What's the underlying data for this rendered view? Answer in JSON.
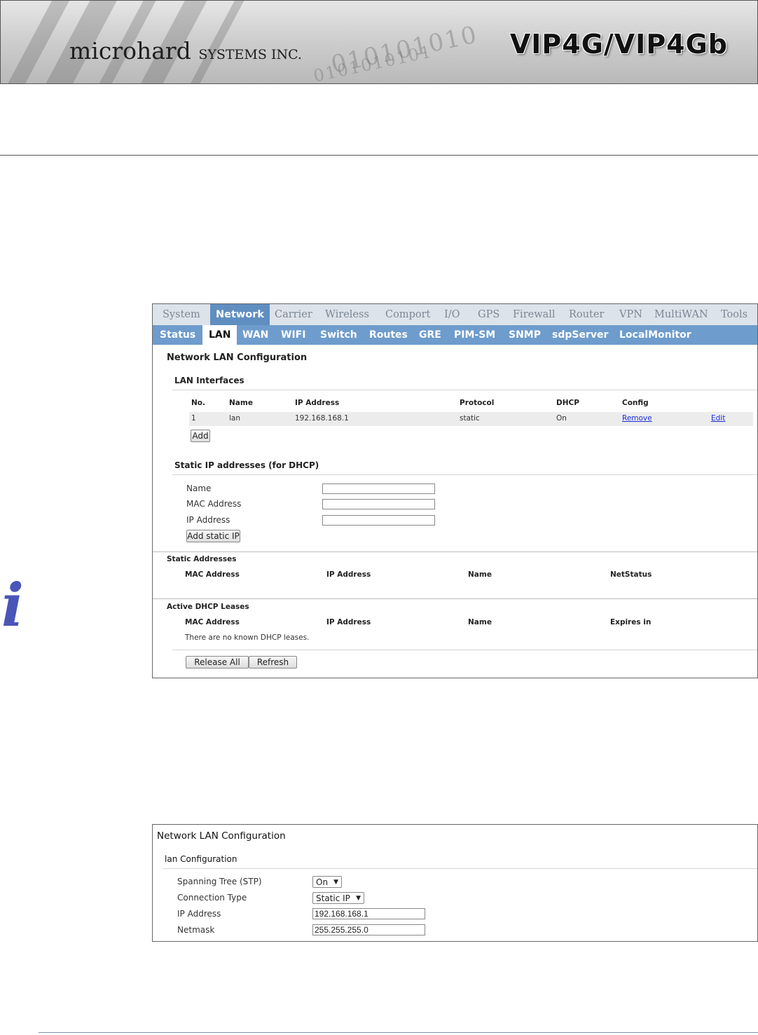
{
  "header": {
    "brand_main": "microhard",
    "brand_sub": "SYSTEMS INC.",
    "product": "VIP4G/VIP4Gb",
    "binary_1": "010101010",
    "binary_2": "0101010101"
  },
  "screenshot1": {
    "main_tabs": [
      "System",
      "Network",
      "Carrier",
      "Wireless",
      "Comport",
      "I/O",
      "GPS",
      "Firewall",
      "Router",
      "VPN",
      "MultiWAN",
      "Tools"
    ],
    "active_main_tab": "Network",
    "sub_tabs": [
      "Status",
      "LAN",
      "WAN",
      "WIFI",
      "Switch",
      "Routes",
      "GRE",
      "PIM-SM",
      "SNMP",
      "sdpServer",
      "LocalMonitor"
    ],
    "active_sub_tab": "LAN",
    "page_title": "Network LAN Configuration",
    "lan_interfaces": {
      "title": "LAN Interfaces",
      "columns": [
        "No.",
        "Name",
        "IP Address",
        "Protocol",
        "DHCP",
        "Config"
      ],
      "rows": [
        {
          "no": "1",
          "name": "lan",
          "ip": "192.168.168.1",
          "protocol": "static",
          "dhcp": "On",
          "remove": "Remove",
          "edit": "Edit"
        }
      ],
      "add_button": "Add"
    },
    "static_ip": {
      "title": "Static IP addresses (for DHCP)",
      "name_label": "Name",
      "mac_label": "MAC Address",
      "ip_label": "IP Address",
      "name_value": "",
      "mac_value": "",
      "ip_value": "",
      "add_button": "Add static IP"
    },
    "static_addresses": {
      "title": "Static Addresses",
      "columns": [
        "MAC Address",
        "IP Address",
        "Name",
        "NetStatus"
      ]
    },
    "dhcp_leases": {
      "title": "Active DHCP Leases",
      "columns": [
        "MAC Address",
        "IP Address",
        "Name",
        "Expires in"
      ],
      "empty_text": "There are no known DHCP leases."
    },
    "release_all_button": "Release All",
    "refresh_button": "Refresh"
  },
  "screenshot2": {
    "page_title": "Network LAN Configuration",
    "section_title": "lan Configuration",
    "fields": {
      "stp_label": "Spanning Tree (STP)",
      "stp_value": "On",
      "conn_label": "Connection Type",
      "conn_value": "Static IP",
      "ip_label": "IP Address",
      "ip_value": "192.168.168.1",
      "netmask_label": "Netmask",
      "netmask_value": "255.255.255.0"
    }
  }
}
